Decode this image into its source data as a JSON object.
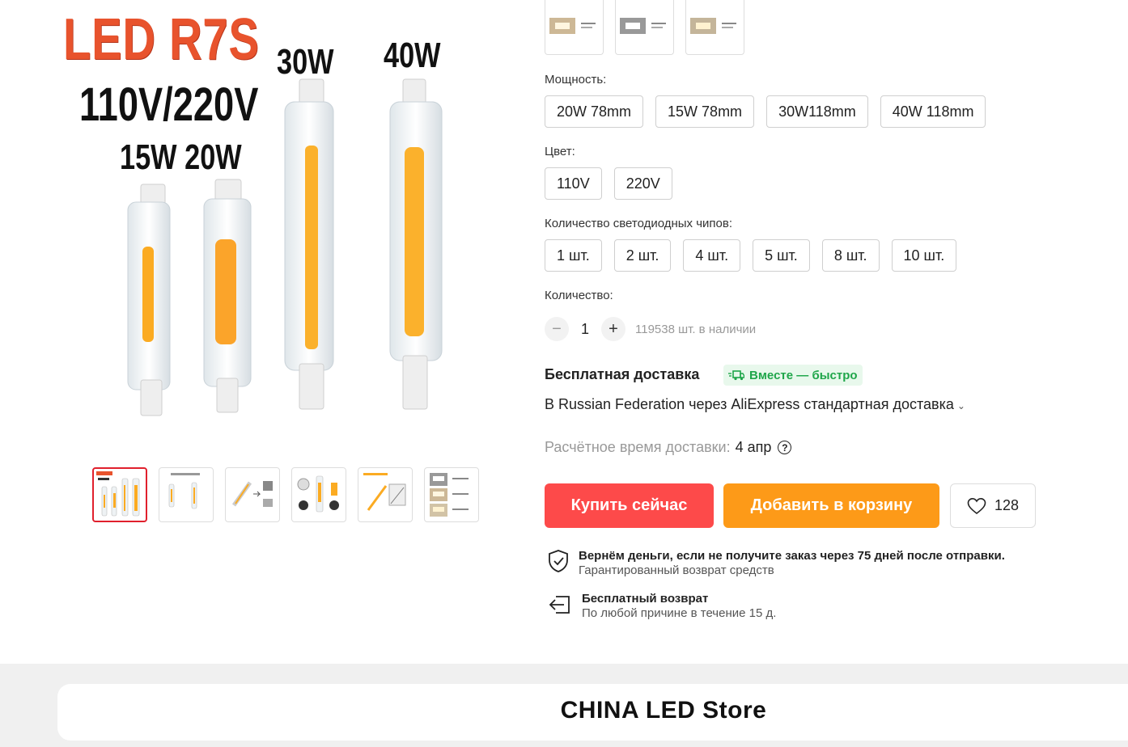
{
  "gallery": {
    "main_image_text": {
      "title": "LED R7S",
      "voltage": "110V/220V",
      "small_watts": "15W 20W",
      "watt_30": "30W",
      "watt_40": "40W"
    },
    "thumbnails_count": 6,
    "active_thumbnail": 0
  },
  "options": {
    "power": {
      "label": "Мощность:",
      "values": [
        "20W 78mm",
        "15W 78mm",
        "30W118mm",
        "40W 118mm"
      ]
    },
    "color": {
      "label": "Цвет:",
      "values": [
        "110V",
        "220V"
      ]
    },
    "chips": {
      "label": "Количество светодиодных чипов:",
      "values": [
        "1 шт.",
        "2 шт.",
        "4 шт.",
        "5 шт.",
        "8 шт.",
        "10 шт."
      ]
    }
  },
  "quantity": {
    "label": "Количество:",
    "value": "1",
    "minus": "−",
    "plus": "+",
    "stock": "119538 шт. в наличии"
  },
  "shipping": {
    "title": "Бесплатная доставка",
    "badge": "Вместе — быстро",
    "method": "В Russian Federation через AliExpress стандартная доставка",
    "eta_label": "Расчётное время доставки:",
    "eta_date": "4 апр",
    "help": "?"
  },
  "actions": {
    "buy_now": "Купить сейчас",
    "add_to_cart": "Добавить в корзину",
    "wishlist_count": "128"
  },
  "guarantees": [
    {
      "title": "Вернём деньги, если не получите заказ через 75 дней после отправки.",
      "sub": "Гарантированный возврат средств"
    },
    {
      "title": "Бесплатный возврат",
      "sub": "По любой причине в течение 15 д."
    }
  ],
  "store": {
    "name": "CHINA LED Store"
  },
  "colors": {
    "buy": "#fd4a4a",
    "cart": "#fd9a18",
    "badge_green": "#1fa64a",
    "active_thumb_border": "#e0202d"
  }
}
